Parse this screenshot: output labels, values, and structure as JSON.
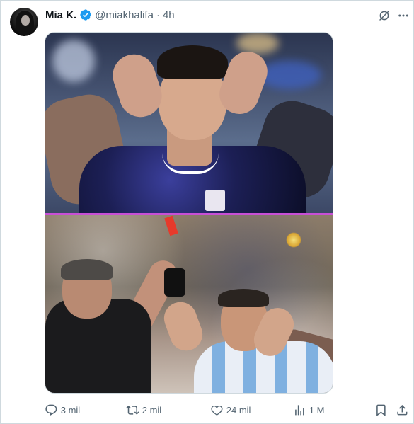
{
  "post": {
    "author": {
      "display_name": "Mia K.",
      "handle": "@miakhalifa",
      "verified": true,
      "avatar": "author-avatar"
    },
    "separator": "·",
    "time": "4h",
    "header_icons": [
      "grok-icon",
      "more-icon"
    ],
    "media": {
      "images": [
        "celebrating-player-photo",
        "red-card-photo"
      ],
      "divider_color": "#c84fd6"
    },
    "actions": {
      "replies": "3 mil",
      "reposts": "2 mil",
      "likes": "24 mil",
      "views": "1 M",
      "bookmark_icon": "bookmark-icon",
      "share_icon": "share-icon"
    }
  },
  "colors": {
    "text": "#0f1419",
    "secondary": "#536471",
    "verified": "#1d9bf0",
    "border": "#cfd9de"
  }
}
